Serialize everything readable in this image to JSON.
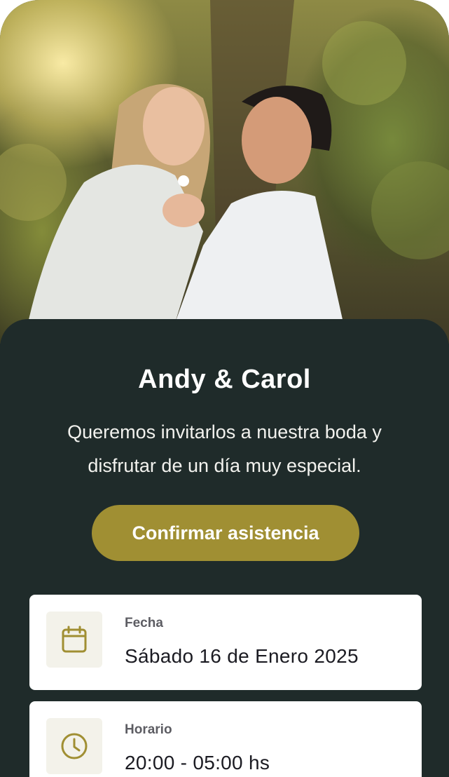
{
  "hero": {
    "photo_icon": "couple-photo"
  },
  "event": {
    "couple_names": "Andy & Carol",
    "invitation_text": "Queremos invitarlos a nuestra boda y disfrutar de un día muy especial.",
    "rsvp_label": "Confirmar asistencia"
  },
  "details": {
    "date": {
      "label": "Fecha",
      "value": "Sábado 16 de Enero 2025",
      "icon": "calendar-icon"
    },
    "time": {
      "label": "Horario",
      "value": "20:00 - 05:00 hs",
      "icon": "clock-icon"
    }
  },
  "colors": {
    "background": "#1f2b2a",
    "accent": "#a08f33",
    "card": "#ffffff"
  }
}
